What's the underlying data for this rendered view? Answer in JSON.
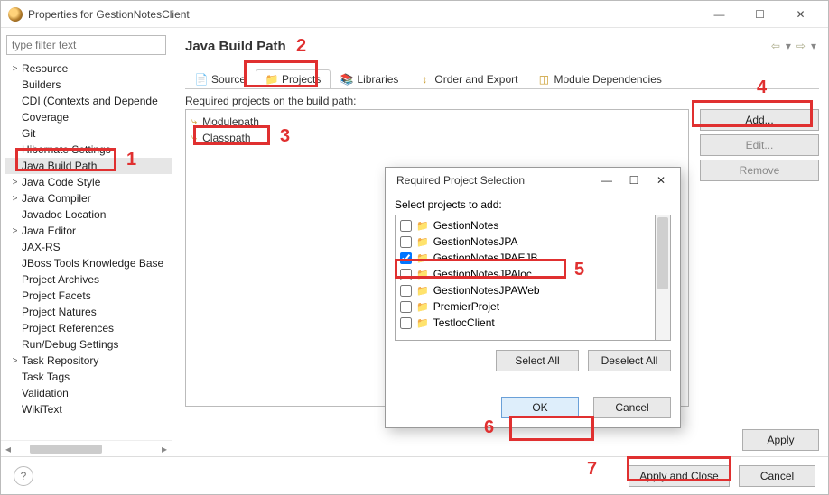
{
  "window": {
    "title": "Properties for GestionNotesClient"
  },
  "filter": {
    "placeholder": "type filter text"
  },
  "left_items": [
    {
      "label": "Resource",
      "expand": ">"
    },
    {
      "label": "Builders",
      "expand": ""
    },
    {
      "label": "CDI (Contexts and Depende",
      "expand": ""
    },
    {
      "label": "Coverage",
      "expand": ""
    },
    {
      "label": "Git",
      "expand": ""
    },
    {
      "label": "Hibernate Settings",
      "expand": ""
    },
    {
      "label": "Java Build Path",
      "expand": "",
      "selected": true
    },
    {
      "label": "Java Code Style",
      "expand": ">"
    },
    {
      "label": "Java Compiler",
      "expand": ">"
    },
    {
      "label": "Javadoc Location",
      "expand": ""
    },
    {
      "label": "Java Editor",
      "expand": ">"
    },
    {
      "label": "JAX-RS",
      "expand": ""
    },
    {
      "label": "JBoss Tools Knowledge Base",
      "expand": ""
    },
    {
      "label": "Project Archives",
      "expand": ""
    },
    {
      "label": "Project Facets",
      "expand": ""
    },
    {
      "label": "Project Natures",
      "expand": ""
    },
    {
      "label": "Project References",
      "expand": ""
    },
    {
      "label": "Run/Debug Settings",
      "expand": ""
    },
    {
      "label": "Task Repository",
      "expand": ">"
    },
    {
      "label": "Task Tags",
      "expand": ""
    },
    {
      "label": "Validation",
      "expand": ""
    },
    {
      "label": "WikiText",
      "expand": ""
    }
  ],
  "page": {
    "title": "Java Build Path",
    "required_label": "Required projects on the build path:"
  },
  "tabs": [
    {
      "label": "Source"
    },
    {
      "label": "Projects",
      "active": true
    },
    {
      "label": "Libraries"
    },
    {
      "label": "Order and Export"
    },
    {
      "label": "Module Dependencies"
    }
  ],
  "paths": [
    {
      "label": "Modulepath"
    },
    {
      "label": "Classpath"
    }
  ],
  "side_buttons": {
    "add": "Add...",
    "edit": "Edit...",
    "remove": "Remove"
  },
  "apply": "Apply",
  "footer": {
    "apply_close": "Apply and Close",
    "cancel": "Cancel"
  },
  "modal": {
    "title": "Required Project Selection",
    "prompt": "Select projects to add:",
    "items": [
      {
        "label": "GestionNotes",
        "checked": false
      },
      {
        "label": "GestionNotesJPA",
        "checked": false
      },
      {
        "label": "GestionNotesJPAEJB",
        "checked": true
      },
      {
        "label": "GestionNotesJPAloc",
        "checked": false
      },
      {
        "label": "GestionNotesJPAWeb",
        "checked": false
      },
      {
        "label": "PremierProjet",
        "checked": false
      },
      {
        "label": "TestlocClient",
        "checked": false
      }
    ],
    "select_all": "Select All",
    "deselect_all": "Deselect All",
    "ok": "OK",
    "cancel": "Cancel"
  },
  "annotations": {
    "1": "1",
    "2": "2",
    "3": "3",
    "4": "4",
    "5": "5",
    "6": "6",
    "7": "7"
  }
}
